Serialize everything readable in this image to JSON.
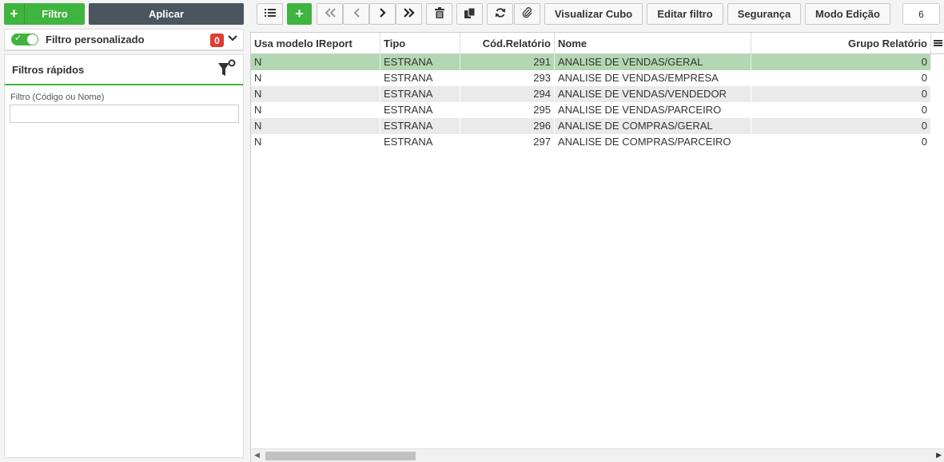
{
  "left": {
    "filtro_label": "Filtro",
    "aplicar_label": "Aplicar",
    "custom_filter_label": "Filtro personalizado",
    "custom_filter_count": "0",
    "quick_filters_title": "Filtros rápidos",
    "field_label": "Filtro (Código ou Nome)",
    "field_value": ""
  },
  "toolbar": {
    "list_icon": "list-icon",
    "add_icon": "plus-icon",
    "first_icon": "double-chevron-left-icon",
    "prev_icon": "chevron-left-icon",
    "next_icon": "chevron-right-icon",
    "last_icon": "double-chevron-right-icon",
    "delete_icon": "trash-icon",
    "copy_icon": "copy-icon",
    "refresh_icon": "refresh-icon",
    "attach_icon": "paperclip-icon",
    "visualizar_cubo": "Visualizar Cubo",
    "editar_filtro": "Editar filtro",
    "seguranca": "Segurança",
    "modo_edicao": "Modo Edição",
    "record_count": "6"
  },
  "grid": {
    "columns": [
      "Usa modelo IReport",
      "Tipo",
      "Cód.Relatório",
      "Nome",
      "Grupo Relatório"
    ],
    "rows": [
      [
        "N",
        "ESTRANA",
        "291",
        "ANALISE DE VENDAS/GERAL",
        "0"
      ],
      [
        "N",
        "ESTRANA",
        "293",
        "ANALISE DE VENDAS/EMPRESA",
        "0"
      ],
      [
        "N",
        "ESTRANA",
        "294",
        "ANALISE DE VENDAS/VENDEDOR",
        "0"
      ],
      [
        "N",
        "ESTRANA",
        "295",
        "ANALISE DE VENDAS/PARCEIRO",
        "0"
      ],
      [
        "N",
        "ESTRANA",
        "296",
        "ANALISE DE COMPRAS/GERAL",
        "0"
      ],
      [
        "N",
        "ESTRANA",
        "297",
        "ANALISE DE COMPRAS/PARCEIRO",
        "0"
      ]
    ]
  },
  "colors": {
    "accent_green": "#3fb43f",
    "dark_button": "#4a5560",
    "selected_row": "#b3d7b3",
    "badge_red": "#e03c31"
  }
}
